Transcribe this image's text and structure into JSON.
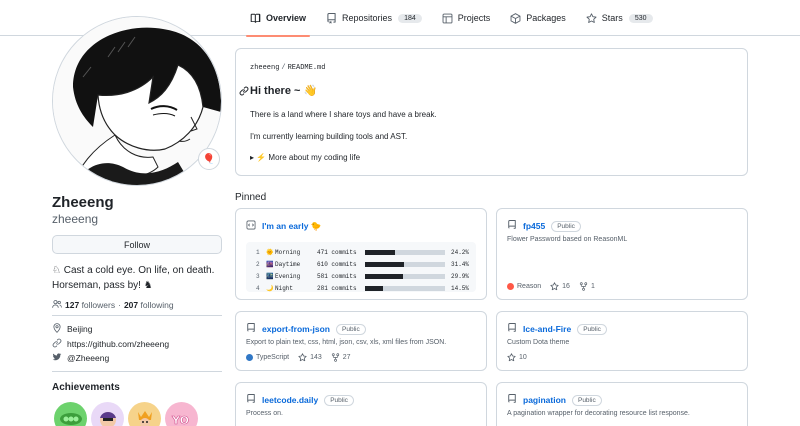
{
  "nav": {
    "tabs": [
      {
        "label": "Overview",
        "icon": "book-icon",
        "count": ""
      },
      {
        "label": "Repositories",
        "icon": "repo-icon",
        "count": "184"
      },
      {
        "label": "Projects",
        "icon": "table-icon",
        "count": ""
      },
      {
        "label": "Packages",
        "icon": "package-icon",
        "count": ""
      },
      {
        "label": "Stars",
        "icon": "star-icon",
        "count": "530"
      }
    ],
    "active_accent": "#fd8c73"
  },
  "profile": {
    "full_name": "Zheeeng",
    "login": "zheeeng",
    "status_emoji": "🎈",
    "follow_label": "Follow",
    "bio": "♘ Cast a cold eye. On life, on death. Horseman, pass by! ♞",
    "followers_count": "127",
    "followers_label": "followers",
    "dot": "·",
    "following_count": "207",
    "following_label": "following",
    "location": "Beijing",
    "website": "https://github.com/zheeeng",
    "twitter": "@Zheeeng",
    "achievements_title": "Achievements"
  },
  "readme": {
    "owner": "zheeeng",
    "file": "README.md",
    "heading": "Hi there ~ 👋",
    "line1": "There is a land where I share toys and have a break.",
    "line2": "I'm currently learning building tools and AST.",
    "details": "▸ ⚡ More about my coding life"
  },
  "pinned": {
    "title": "Pinned",
    "gist": {
      "name": "I'm an early 🐤",
      "rows": [
        {
          "n": "1",
          "emoji": "🌞",
          "label": "Morning",
          "commits": "471 commits",
          "fraction": 0.242,
          "pct": "24.2%"
        },
        {
          "n": "2",
          "emoji": "🌆",
          "label": "Daytime",
          "commits": "610 commits",
          "fraction": 0.314,
          "pct": "31.4%"
        },
        {
          "n": "3",
          "emoji": "🌃",
          "label": "Evening",
          "commits": "581 commits",
          "fraction": 0.299,
          "pct": "29.9%"
        },
        {
          "n": "4",
          "emoji": "🌙",
          "label": "Night",
          "commits": "281 commits",
          "fraction": 0.145,
          "pct": "14.5%"
        }
      ]
    },
    "repos": [
      {
        "name": "fp455",
        "visibility": "Public",
        "desc": "Flower Password based on ReasonML",
        "lang": "Reason",
        "lang_color": "#ff5847",
        "stars": "16",
        "forks": "1"
      },
      {
        "name": "export-from-json",
        "visibility": "Public",
        "desc": "Export to plain text, css, html, json, csv, xls, xml files from JSON.",
        "lang": "TypeScript",
        "lang_color": "#3178c6",
        "stars": "143",
        "forks": "27"
      },
      {
        "name": "Ice-and-Fire",
        "visibility": "Public",
        "desc": "Custom Dota theme",
        "lang": "",
        "lang_color": "",
        "stars": "10",
        "forks": ""
      },
      {
        "name": "leetcode.daily",
        "visibility": "Public",
        "desc": "Process on.",
        "lang": "",
        "lang_color": "",
        "stars": "",
        "forks": ""
      },
      {
        "name": "pagination",
        "visibility": "Public",
        "desc": "A pagination wrapper for decorating resource list response.",
        "lang": "",
        "lang_color": "",
        "stars": "",
        "forks": ""
      }
    ]
  },
  "colors": {
    "link": "#0969da",
    "border": "#d0d7de",
    "muted": "#57606a"
  }
}
